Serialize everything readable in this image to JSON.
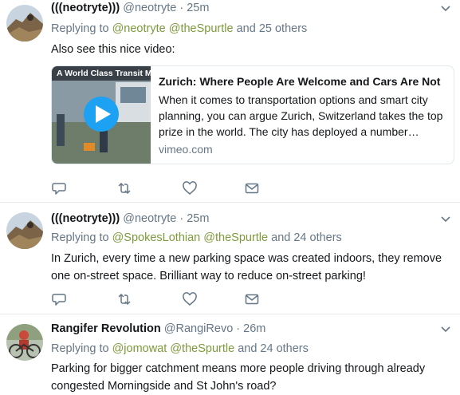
{
  "tweets": [
    {
      "name": "(((neotryte)))",
      "handle": "@neotryte",
      "time": "· 25m",
      "replying_prefix": "Replying to",
      "replying_links": [
        "@neotryte",
        "@theSpurtle"
      ],
      "replying_suffix": "and 25 others",
      "text": "Also see this nice video:",
      "card": {
        "thumb_caption": "A World Class Transit Met",
        "title": "Zurich: Where People Are Welcome and Cars Are Not",
        "description": "When it comes to transportation options and smart city planning, you can argue Zurich, Switzerland takes the top prize in the world. The city has deployed a number…",
        "domain": "vimeo.com"
      }
    },
    {
      "name": "(((neotryte)))",
      "handle": "@neotryte",
      "time": "· 25m",
      "replying_prefix": "Replying to",
      "replying_links": [
        "@SpokesLothian",
        "@theSpurtle"
      ],
      "replying_suffix": "and 24 others",
      "text": "In Zurich, every time a new parking space was created indoors, they remove one on-street space. Brilliant way to reduce on-street parking!"
    },
    {
      "name": "Rangifer Revolution",
      "handle": "@RangiRevo",
      "time": "· 26m",
      "replying_prefix": "Replying to",
      "replying_links": [
        "@jomowat",
        "@theSpurtle"
      ],
      "replying_suffix": "and 24 others",
      "text": "Parking for bigger catchment means more people driving through already congested Morningside and St John's road?"
    }
  ],
  "icons": {
    "reply": "reply-icon",
    "retweet": "retweet-icon",
    "like": "heart-icon",
    "dm": "envelope-icon",
    "menu": "chevron-down-icon",
    "play": "play-icon"
  },
  "colors": {
    "link": "#7e9a3c",
    "secondary": "#657786",
    "play_button": "#1da1f2",
    "divider": "#e6ecf0"
  }
}
